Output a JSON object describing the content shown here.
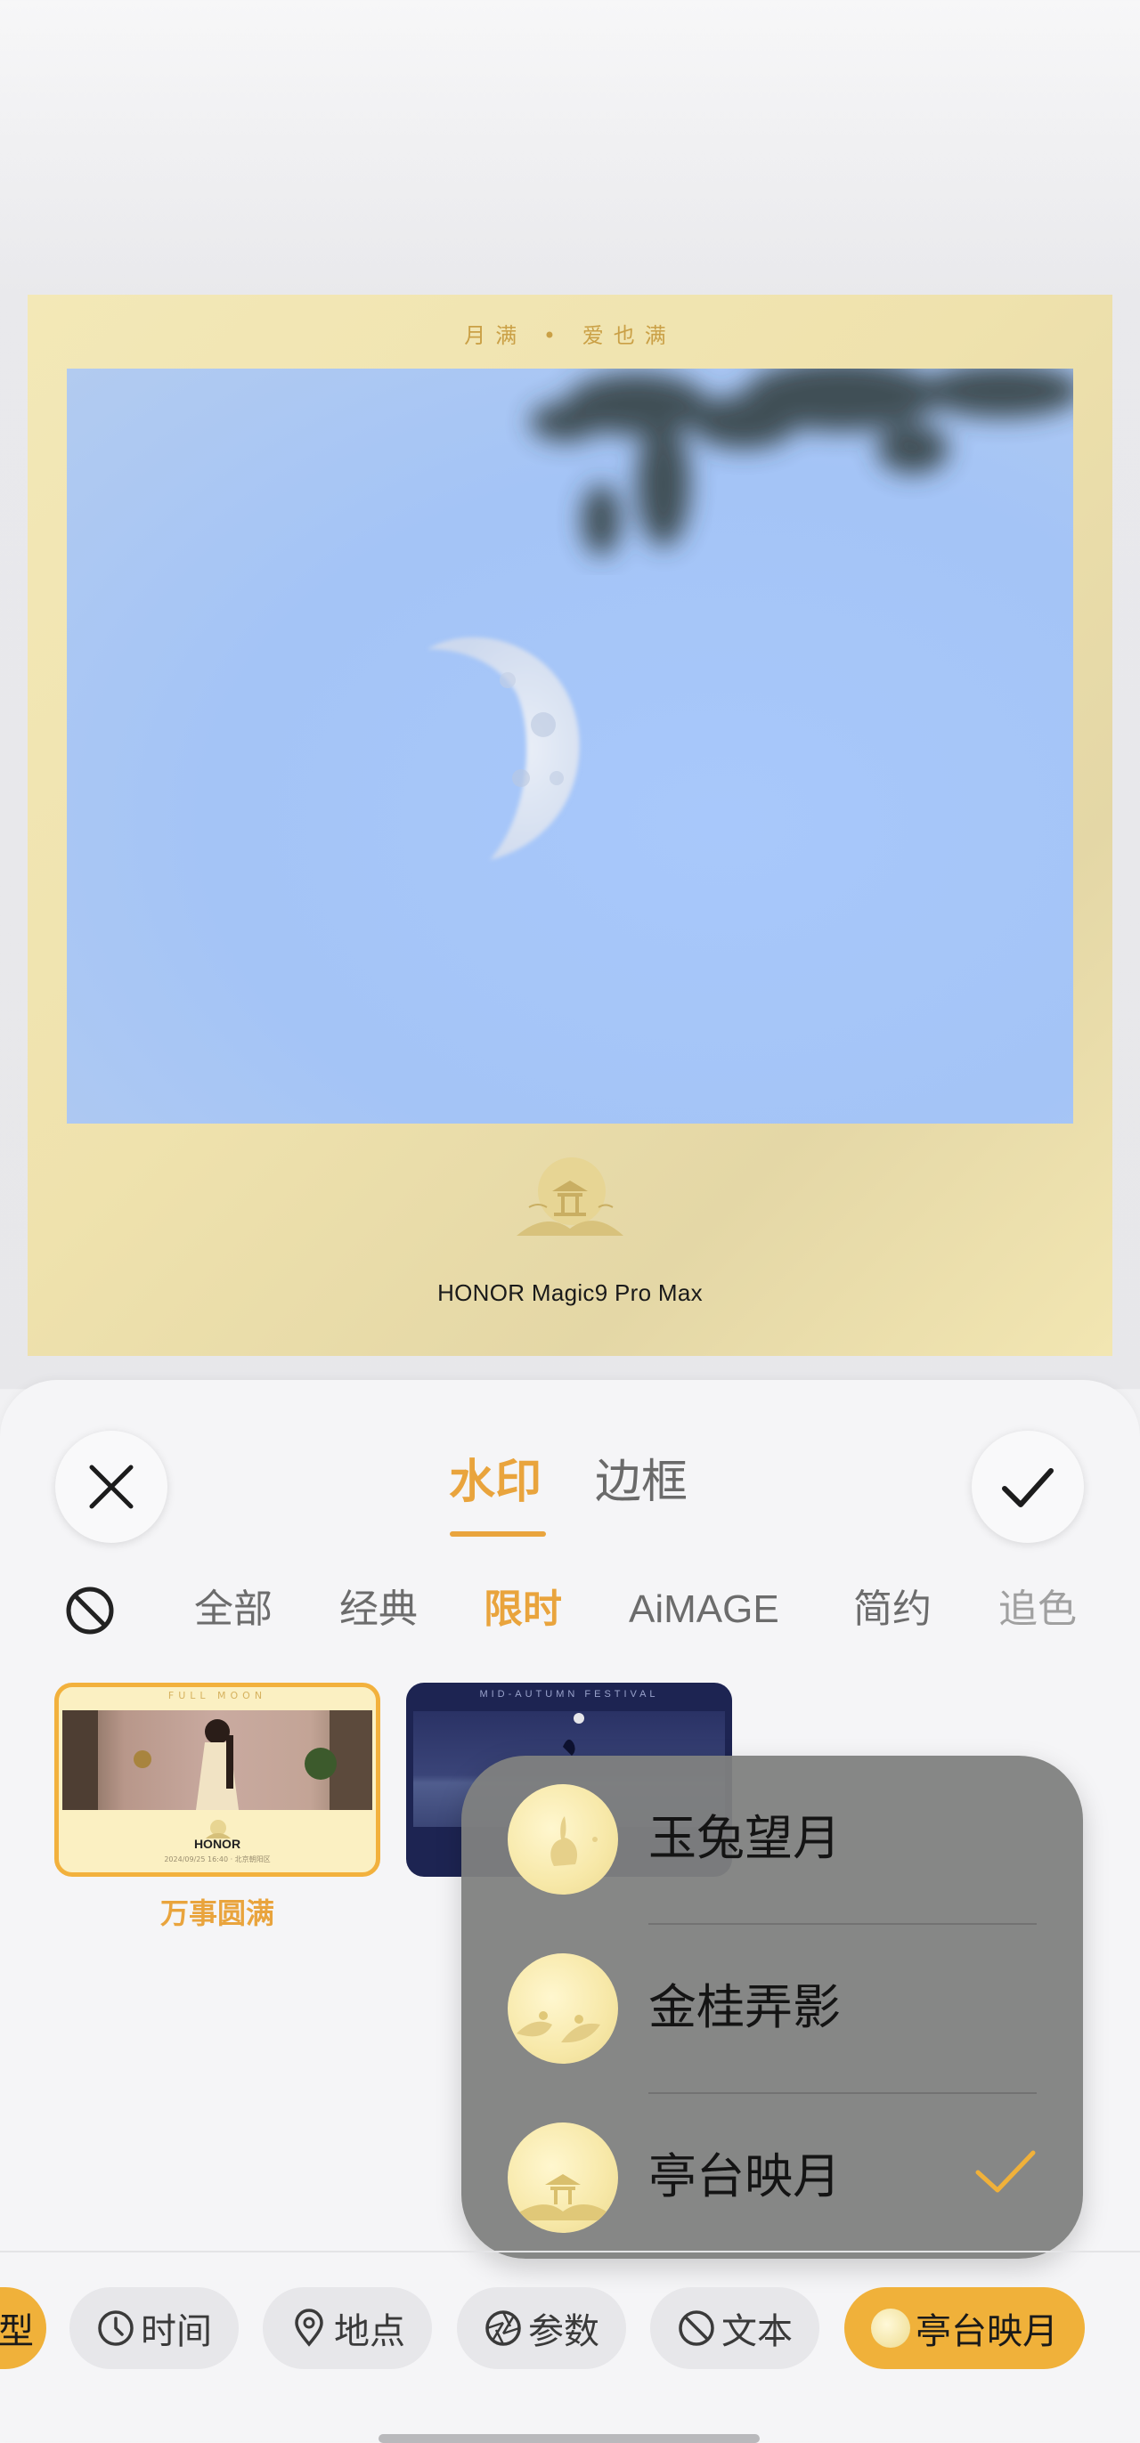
{
  "preview": {
    "frame_title": "月满 • 爱也满",
    "camera_model": "HONOR Magic9 Pro Max",
    "frame_color": "#f1e6b3",
    "sky_color": "#a8c7f8"
  },
  "panel": {
    "tabs": [
      {
        "label": "水印",
        "active": true
      },
      {
        "label": "边框",
        "active": false
      }
    ],
    "categories": [
      {
        "label": "全部",
        "active": false
      },
      {
        "label": "经典",
        "active": false
      },
      {
        "label": "限时",
        "active": true
      },
      {
        "label": "AiMAGE",
        "active": false
      },
      {
        "label": "简约",
        "active": false
      },
      {
        "label": "追色",
        "active": false
      }
    ],
    "accent_color": "#e9a43d"
  },
  "templates": [
    {
      "label": "万事圆满",
      "selected": true,
      "top_text": "FULL MOON",
      "brand": "HONOR",
      "meta": "2024/09/25 16:40 · 北京朝阳区"
    },
    {
      "label": "",
      "selected": false,
      "top_text": "MID-AUTUMN FESTIVAL"
    }
  ],
  "style_menu": {
    "items": [
      {
        "label": "玉兔望月",
        "icon": "rabbit-moon-icon",
        "selected": false
      },
      {
        "label": "金桂弄影",
        "icon": "osmanthus-moon-icon",
        "selected": false
      },
      {
        "label": "亭台映月",
        "icon": "pavilion-moon-icon",
        "selected": true
      }
    ]
  },
  "chips": {
    "cut_label": "型",
    "items": [
      {
        "label": "时间",
        "icon": "clock-icon"
      },
      {
        "label": "地点",
        "icon": "location-pin-icon"
      },
      {
        "label": "参数",
        "icon": "aperture-icon"
      },
      {
        "label": "文本",
        "icon": "no-text-icon"
      },
      {
        "label": "亭台映月",
        "icon": "pavilion-moon-icon",
        "active": true
      }
    ]
  }
}
